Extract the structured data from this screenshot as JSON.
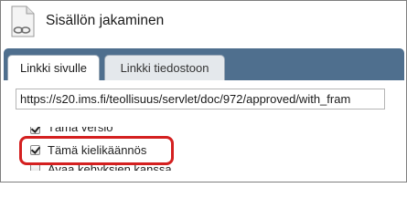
{
  "dialog": {
    "title": "Sisällön jakaminen",
    "icon": "document-link-icon"
  },
  "tabs": [
    {
      "label": "Linkki sivulle",
      "active": true
    },
    {
      "label": "Linkki tiedostoon",
      "active": false
    }
  ],
  "url_field": {
    "value": "https://s20.ims.fi/teollisuus/servlet/doc/972/approved/with_fram"
  },
  "options": [
    {
      "label": "Tämä versio",
      "checked": true
    },
    {
      "label": "Tämä kielikäännös",
      "checked": true
    },
    {
      "label": "Avaa kehyksien kanssa",
      "checked": false
    }
  ],
  "colors": {
    "tab_bar": "#4f6f8e",
    "highlight": "#d42020"
  }
}
